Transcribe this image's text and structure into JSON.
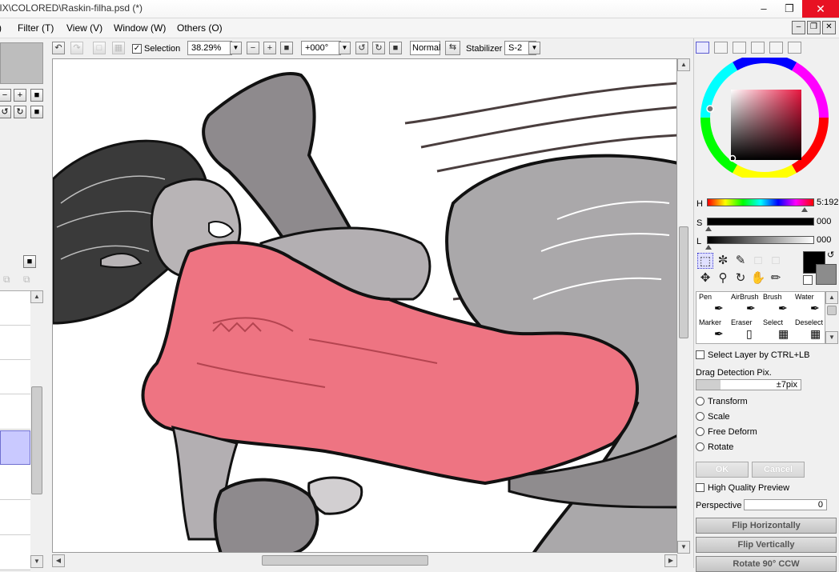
{
  "window": {
    "title": "IIX\\COLORED\\Raskin-filha.psd (*)",
    "minimize": "–",
    "restore": "❐",
    "close": "✕"
  },
  "menu": {
    "items": [
      {
        "label": ")"
      },
      {
        "label": "Filter (T)"
      },
      {
        "label": "View (V)"
      },
      {
        "label": "Window (W)"
      },
      {
        "label": "Others (O)"
      }
    ]
  },
  "toolbar": {
    "selection_label": "Selection",
    "selection_checked": true,
    "zoom_value": "38.29%",
    "rotation_value": "+000°",
    "blend_mode": "Normal",
    "stabilizer_label": "Stabilizer",
    "stabilizer_value": "S-2"
  },
  "color": {
    "h_label": "H",
    "h_value": "5:192",
    "s_label": "S",
    "s_value": "000",
    "l_label": "L",
    "l_value": "000",
    "primary_color": "#000000",
    "secondary_color": "#8c8c8c"
  },
  "tools": {
    "brushes": [
      {
        "label": "Pen"
      },
      {
        "label": "AirBrush"
      },
      {
        "label": "Brush"
      },
      {
        "label": "Water"
      },
      {
        "label": "Marker"
      },
      {
        "label": "Eraser"
      },
      {
        "label": "Select"
      },
      {
        "label": "Deselect"
      }
    ]
  },
  "options": {
    "select_layer_label": "Select Layer by CTRL+LB",
    "drag_detection_label": "Drag Detection Pix.",
    "drag_detection_value": "±7pix",
    "transform_modes": [
      "Transform",
      "Scale",
      "Free Deform",
      "Rotate"
    ],
    "ok_label": "OK",
    "cancel_label": "Cancel",
    "hq_preview_label": "High Quality Preview",
    "perspective_label": "Perspective",
    "perspective_value": "0",
    "flip_h_label": "Flip Horizontally",
    "flip_v_label": "Flip Vertically",
    "rotate_ccw_label": "Rotate 90° CCW"
  },
  "theme": {
    "accent": "#5b5bd0",
    "dress": "#ee7482",
    "skin": "#b8b4b6",
    "hair": "#3a3a3a"
  }
}
